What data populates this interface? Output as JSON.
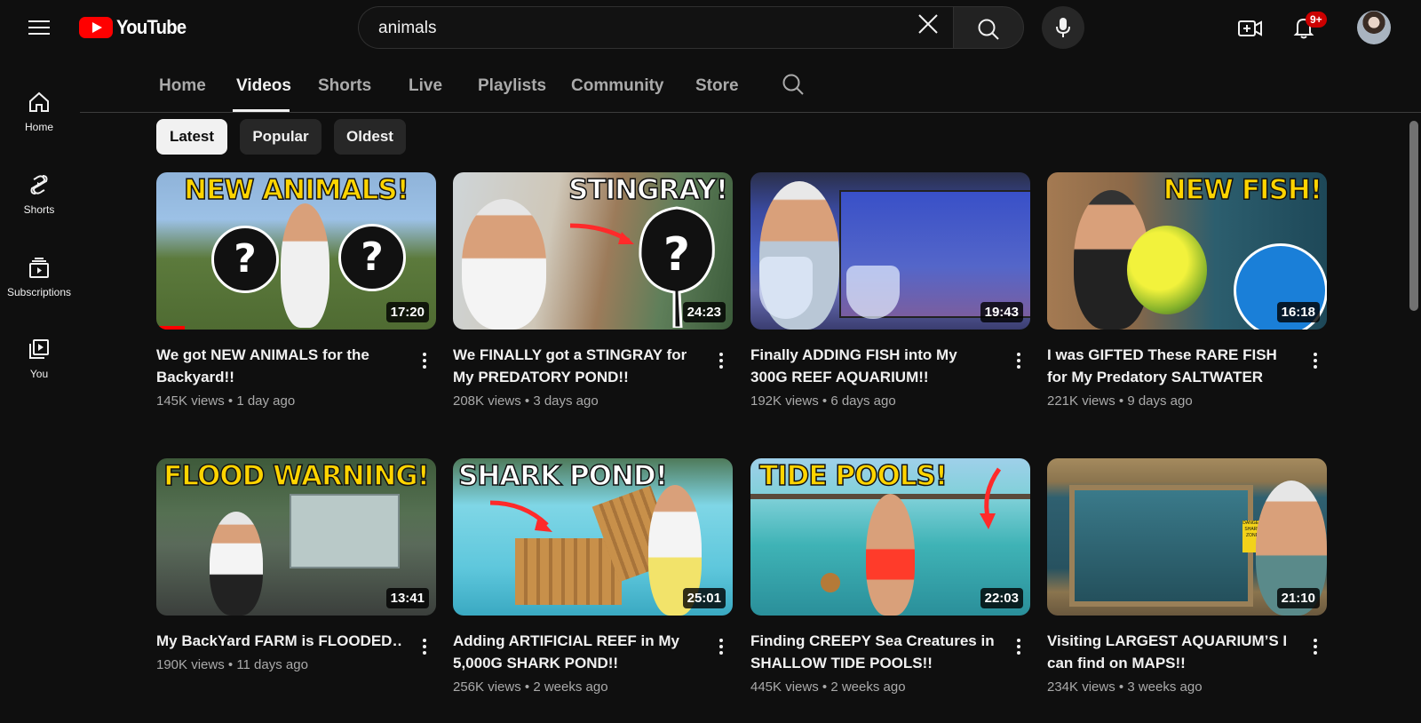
{
  "header": {
    "logo_text": "YouTube",
    "search_value": "animals",
    "notification_count": "9+"
  },
  "sidebar": {
    "items": [
      {
        "label": "Home",
        "icon": "home-icon"
      },
      {
        "label": "Shorts",
        "icon": "shorts-icon"
      },
      {
        "label": "Subscriptions",
        "icon": "subscriptions-icon"
      },
      {
        "label": "You",
        "icon": "you-icon"
      }
    ]
  },
  "tabs": [
    "Home",
    "Videos",
    "Shorts",
    "Live",
    "Playlists",
    "Community",
    "Store"
  ],
  "active_tab": "Videos",
  "chips": [
    "Latest",
    "Popular",
    "Oldest"
  ],
  "active_chip": "Latest",
  "videos": [
    {
      "title": "We got NEW ANIMALS for the Backyard!!",
      "views": "145K views",
      "age": "1 day ago",
      "duration": "17:20",
      "thumb_text": "NEW ANIMALS!",
      "watched": 0.1
    },
    {
      "title": "We FINALLY got a STINGRAY for My PREDATORY POND!!",
      "views": "208K views",
      "age": "3 days ago",
      "duration": "24:23",
      "thumb_text": "STINGRAY!"
    },
    {
      "title": "Finally ADDING FISH into My 300G REEF AQUARIUM!!",
      "views": "192K views",
      "age": "6 days ago",
      "duration": "19:43",
      "thumb_text": ""
    },
    {
      "title": "I was GIFTED These RARE FISH for My Predatory SALTWATER POND!!",
      "views": "221K views",
      "age": "9 days ago",
      "duration": "16:18",
      "thumb_text": "NEW FISH!"
    },
    {
      "title": "My BackYard FARM is FLOODED…",
      "views": "190K views",
      "age": "11 days ago",
      "duration": "13:41",
      "thumb_text": "FLOOD WARNING!"
    },
    {
      "title": "Adding ARTIFICIAL REEF in My 5,000G SHARK POND!!",
      "views": "256K views",
      "age": "2 weeks ago",
      "duration": "25:01",
      "thumb_text": "SHARK POND!"
    },
    {
      "title": "Finding CREEPY Sea Creatures in SHALLOW TIDE POOLS!!",
      "views": "445K views",
      "age": "2 weeks ago",
      "duration": "22:03",
      "thumb_text": "TIDE POOLS!"
    },
    {
      "title": "Visiting LARGEST AQUARIUM’S I can find on MAPS!!",
      "views": "234K views",
      "age": "3 weeks ago",
      "duration": "21:10",
      "thumb_text": "",
      "sign_text": "DANGER SHARK ZONE"
    }
  ],
  "colors": {
    "background": "#0f0f0f",
    "brand_red": "#ff0000",
    "text": "#f1f1f1",
    "muted": "#aaaaaa",
    "chip": "#272727",
    "thumb_accent": "#ffd400"
  }
}
